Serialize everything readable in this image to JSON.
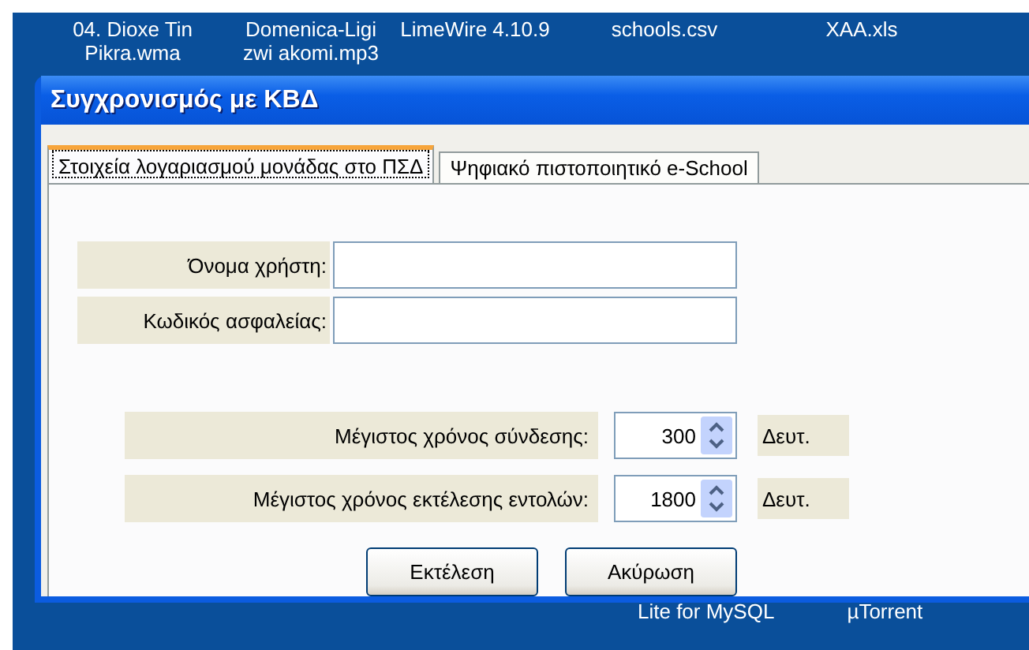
{
  "desktop_icons": [
    {
      "label": "04. Dioxe Tin\nPikra.wma"
    },
    {
      "label": "Domenica-Ligi\nzwi akomi.mp3"
    },
    {
      "label": "LimeWire 4.10.9"
    },
    {
      "label": "schools.csv"
    },
    {
      "label": "XAA.xls"
    }
  ],
  "desktop_icons_below": [
    {
      "label": "Lite for MySQL"
    },
    {
      "label": "µTorrent"
    }
  ],
  "window": {
    "title": "Συγχρονισμός με ΚΒΔ"
  },
  "tabs": [
    {
      "label": "Στοιχεία λογαριασμού μονάδας στο ΠΣΔ",
      "selected": true
    },
    {
      "label": "Ψηφιακό πιστοποιητικό e-School",
      "selected": false
    }
  ],
  "fields": [
    {
      "label": "Όνομα χρήστη:"
    },
    {
      "label": "Κωδικός ασφαλείας:"
    }
  ],
  "spinners": [
    {
      "label": "Μέγιστος χρόνος σύνδεσης:",
      "value": "300",
      "unit": "Δευτ."
    },
    {
      "label": "Μέγιστος χρόνος εκτέλεσης εντολών:",
      "value": "1800",
      "unit": "Δευτ."
    }
  ],
  "buttons": [
    "Εκτέλεση",
    "Ακύρωση"
  ]
}
